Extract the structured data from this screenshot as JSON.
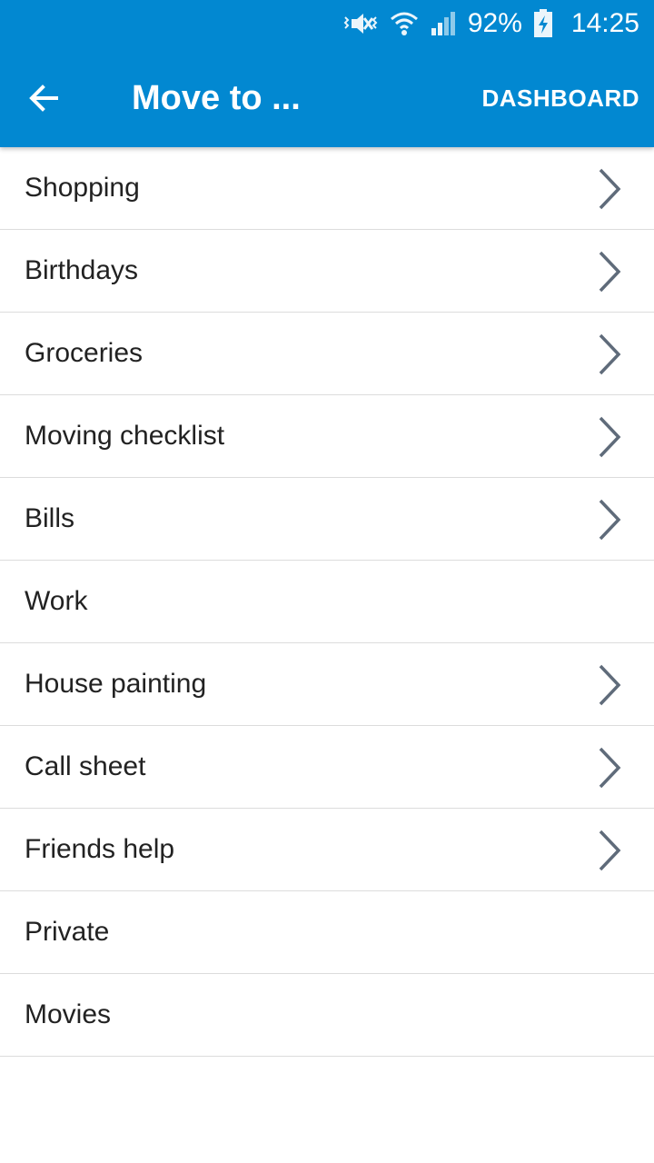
{
  "status_bar": {
    "battery_percent": "92%",
    "time": "14:25",
    "icons": [
      "vibrate-mute-icon",
      "wifi-icon",
      "signal-icon",
      "battery-charging-icon"
    ]
  },
  "toolbar": {
    "title": "Move to ...",
    "action_label": "DASHBOARD",
    "back_icon": "arrow-back-icon",
    "color": "#0288d1"
  },
  "list": {
    "items": [
      {
        "label": "Shopping",
        "has_children": true
      },
      {
        "label": "Birthdays",
        "has_children": true
      },
      {
        "label": "Groceries",
        "has_children": true
      },
      {
        "label": "Moving checklist",
        "has_children": true
      },
      {
        "label": "Bills",
        "has_children": true
      },
      {
        "label": "Work",
        "has_children": false
      },
      {
        "label": "House painting",
        "has_children": true
      },
      {
        "label": "Call sheet",
        "has_children": true
      },
      {
        "label": "Friends help",
        "has_children": true
      },
      {
        "label": "Private",
        "has_children": false
      },
      {
        "label": "Movies",
        "has_children": false
      }
    ]
  }
}
